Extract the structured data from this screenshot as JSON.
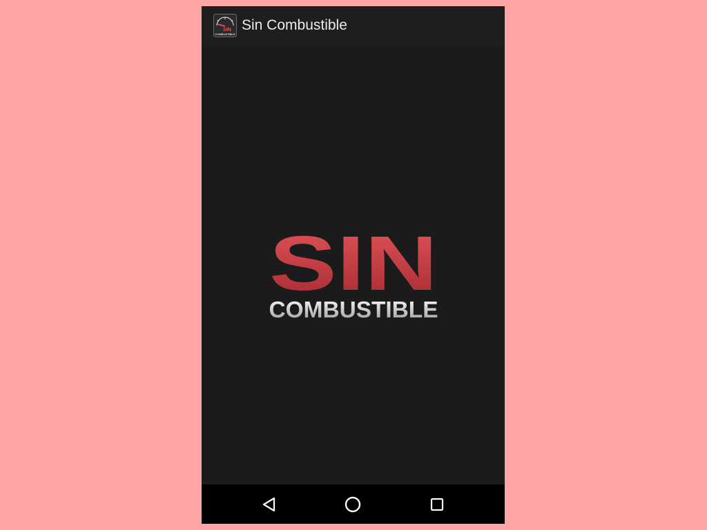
{
  "app_bar": {
    "title": "Sin Combustible",
    "icon": "fuel-gauge-app-icon",
    "icon_text_top": "SIN",
    "icon_text_bottom": "COMBUSTIBLE"
  },
  "splash": {
    "logo_primary": "SIN",
    "logo_secondary": "COMBUSTIBLE"
  },
  "nav_bar": {
    "back_icon": "back-triangle-icon",
    "home_icon": "home-circle-icon",
    "recents_icon": "recents-square-icon"
  },
  "colors": {
    "page_background": "#ffa4a4",
    "app_bar": "#1e1e1e",
    "content_background": "#1b1b1b",
    "nav_bar": "#000000",
    "logo_red_light": "#e2555a",
    "logo_red_dark": "#a32a30",
    "logo_silver_light": "#ffffff",
    "logo_silver_dark": "#9a9a9a"
  }
}
